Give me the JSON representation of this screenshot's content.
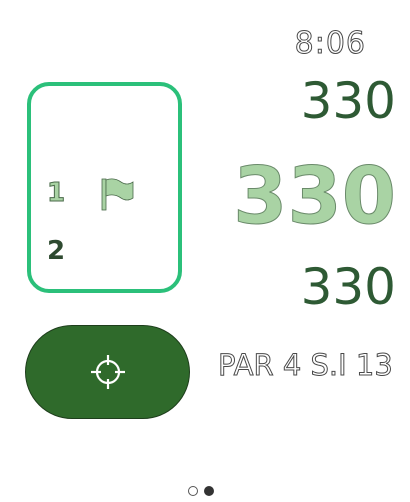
{
  "status_bar": {
    "time": "8:06"
  },
  "hole_list": {
    "current_hole": "1",
    "next_hole": "2",
    "flag_icon": "flag-icon",
    "accent_color": "#2bc07a"
  },
  "distances": {
    "back": "330",
    "middle": "330",
    "front": "330"
  },
  "target_button": {
    "icon": "crosshair-icon",
    "color": "#2f6a2b"
  },
  "hole_info": {
    "text": "PAR 4 S.I 13"
  },
  "pager": {
    "page_count": 2,
    "active_page": 2
  }
}
